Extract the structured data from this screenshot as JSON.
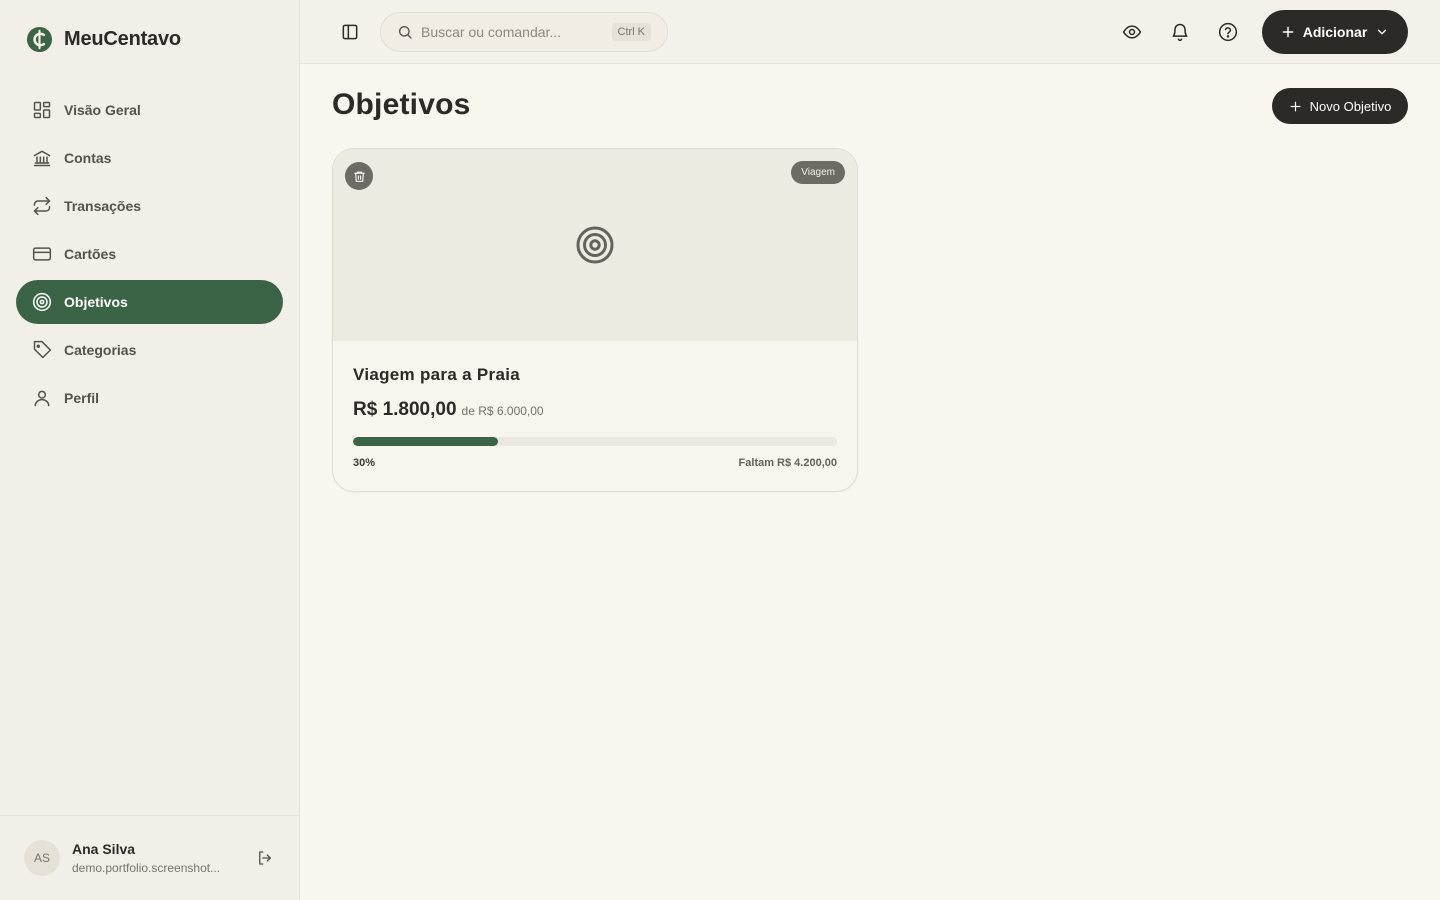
{
  "brand": {
    "name": "MeuCentavo",
    "icon": "cent-logo-icon"
  },
  "sidebar": {
    "items": [
      {
        "label": "Visão Geral",
        "icon": "dashboard-grid-icon",
        "active": false
      },
      {
        "label": "Contas",
        "icon": "bank-icon",
        "active": false
      },
      {
        "label": "Transações",
        "icon": "arrows-exchange-icon",
        "active": false
      },
      {
        "label": "Cartões",
        "icon": "credit-card-icon",
        "active": false
      },
      {
        "label": "Objetivos",
        "icon": "target-icon",
        "active": true
      },
      {
        "label": "Categorias",
        "icon": "tag-icon",
        "active": false
      },
      {
        "label": "Perfil",
        "icon": "user-icon",
        "active": false
      }
    ],
    "user": {
      "initials": "AS",
      "name": "Ana Silva",
      "email": "demo.portfolio.screenshot..."
    }
  },
  "header": {
    "search_placeholder": "Buscar ou comandar...",
    "shortcut": "Ctrl K",
    "add_label": "Adicionar"
  },
  "main": {
    "title": "Objetivos",
    "new_button_label": "Novo Objetivo",
    "goals": [
      {
        "category": "Viagem",
        "name": "Viagem para a Praia",
        "saved": "R$ 1.800,00",
        "target": "de R$ 6.000,00",
        "progress": 0.3,
        "percent_label": "30%",
        "remaining_label": "Faltam R$ 4.200,00"
      }
    ]
  },
  "colors": {
    "accent": "#3b6447",
    "dark": "#2b2a27",
    "background": "#f9f6f0",
    "sidebar": "#f2efe8"
  }
}
